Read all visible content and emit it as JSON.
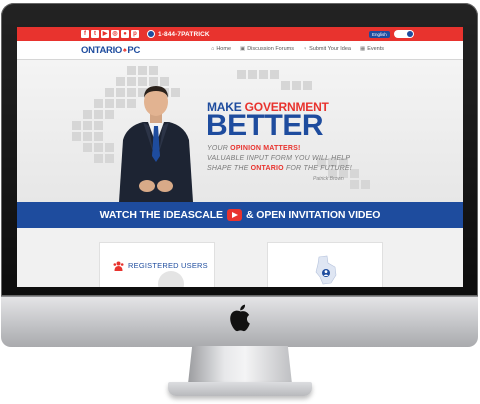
{
  "topbar": {
    "social_icons": [
      "facebook-icon",
      "twitter-icon",
      "youtube-icon",
      "instagram-icon",
      "flickr-icon",
      "pinterest-icon"
    ],
    "social_glyphs": [
      "f",
      "t",
      "▶",
      "◎",
      "●",
      "p"
    ],
    "phone": "1-844-7PATRICK",
    "language_label": "English"
  },
  "brand": {
    "ontario": "ONTARIO",
    "pc": "PC"
  },
  "nav": {
    "items": [
      {
        "label": "Home",
        "icon": "home-icon"
      },
      {
        "label": "Discussion Forums",
        "icon": "forum-icon"
      },
      {
        "label": "Submit Your Idea",
        "icon": "lightbulb-icon"
      },
      {
        "label": "Events",
        "icon": "calendar-icon"
      }
    ]
  },
  "hero": {
    "headline_make": "MAKE ",
    "headline_government": "GOVERNMENT",
    "headline_better": "BETTER",
    "line1_prefix": "YOUR ",
    "line1_highlight": "OPINION MATTERS!",
    "line2": "VALUABLE INPUT FORM YOU WILL HELP",
    "line3_prefix": "SHAPE THE ",
    "line3_highlight": "ONTARIO",
    "line3_suffix": " FOR THE FUTURE!",
    "signature": "Patrick Brown"
  },
  "video_banner": {
    "left_text": "WATCH THE IDEASCALE",
    "right_text": "& OPEN INVITATION VIDEO"
  },
  "cards": {
    "registered_users_label": "REGISTERED USERS"
  },
  "colors": {
    "red": "#e8332e",
    "blue": "#1e4c9e",
    "screen_bg": "#f1f1f1"
  }
}
